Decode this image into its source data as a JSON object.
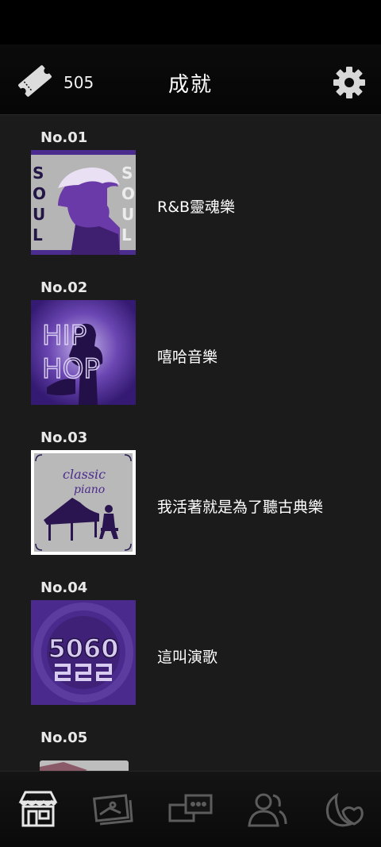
{
  "header": {
    "ticket_count": "505",
    "title": "成就",
    "ticket_icon": "ticket-icon",
    "settings_icon": "gear-icon"
  },
  "achievements": [
    {
      "no": "No.01",
      "name": "R&B靈魂樂",
      "cover_text": "SOUL"
    },
    {
      "no": "No.02",
      "name": "嘻哈音樂",
      "cover_text": "HIP HOP"
    },
    {
      "no": "No.03",
      "name": "我活著就是為了聽古典樂",
      "cover_text_1": "classic",
      "cover_text_2": "piano"
    },
    {
      "no": "No.04",
      "name": "這叫演歌",
      "cover_text": "5060"
    },
    {
      "no": "No.05",
      "name": ""
    }
  ],
  "bottom_nav": [
    {
      "icon": "shop-icon",
      "active": true
    },
    {
      "icon": "album-icon",
      "active": false
    },
    {
      "icon": "chat-icon",
      "active": false
    },
    {
      "icon": "friends-icon",
      "active": false
    },
    {
      "icon": "moon-icon",
      "active": false
    }
  ],
  "colors": {
    "background": "#1b1b1b",
    "header": "#070707",
    "accent_purple": "#4a2a8c"
  }
}
